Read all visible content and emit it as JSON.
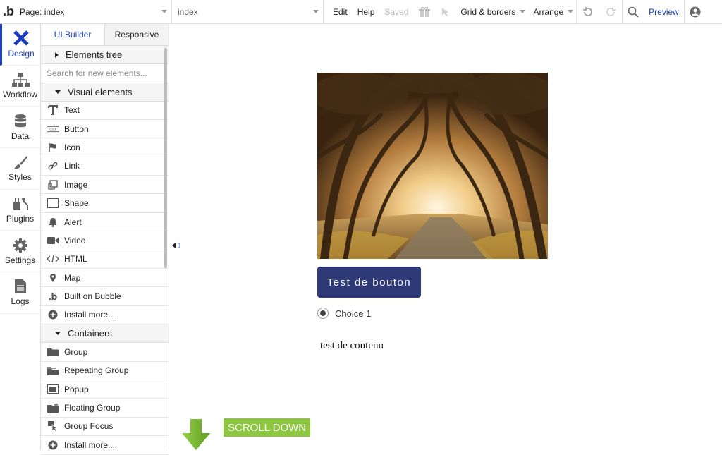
{
  "topbar": {
    "logo": ".b",
    "page_select": "Page: index",
    "element_select": "index",
    "edit": "Edit",
    "help": "Help",
    "saved": "Saved",
    "grid_borders": "Grid & borders",
    "arrange": "Arrange",
    "preview": "Preview"
  },
  "rail": {
    "items": [
      {
        "label": "Design",
        "icon": "design-icon",
        "active": true
      },
      {
        "label": "Workflow",
        "icon": "workflow-icon"
      },
      {
        "label": "Data",
        "icon": "data-icon"
      },
      {
        "label": "Styles",
        "icon": "styles-icon"
      },
      {
        "label": "Plugins",
        "icon": "plugins-icon"
      },
      {
        "label": "Settings",
        "icon": "settings-icon"
      },
      {
        "label": "Logs",
        "icon": "logs-icon"
      }
    ]
  },
  "palette": {
    "tabs": [
      "UI Builder",
      "Responsive"
    ],
    "elements_tree": "Elements tree",
    "search_placeholder": "Search for new elements...",
    "visual_elements_header": "Visual elements",
    "visual_elements": [
      {
        "label": "Text",
        "icon": "text-icon"
      },
      {
        "label": "Button",
        "icon": "button-icon"
      },
      {
        "label": "Icon",
        "icon": "flag-icon"
      },
      {
        "label": "Link",
        "icon": "link-icon"
      },
      {
        "label": "Image",
        "icon": "image-icon"
      },
      {
        "label": "Shape",
        "icon": "shape-icon"
      },
      {
        "label": "Alert",
        "icon": "bell-icon"
      },
      {
        "label": "Video",
        "icon": "video-icon"
      },
      {
        "label": "HTML",
        "icon": "code-icon"
      },
      {
        "label": "Map",
        "icon": "map-pin-icon"
      },
      {
        "label": "Built on Bubble",
        "icon": "bubble-logo-icon"
      },
      {
        "label": "Install more...",
        "icon": "plus-circle-icon"
      }
    ],
    "containers_header": "Containers",
    "containers": [
      {
        "label": "Group",
        "icon": "folder-icon"
      },
      {
        "label": "Repeating Group",
        "icon": "folder-stack-icon"
      },
      {
        "label": "Popup",
        "icon": "popup-icon"
      },
      {
        "label": "Floating Group",
        "icon": "folder-icon"
      },
      {
        "label": "Group Focus",
        "icon": "cursor-icon"
      },
      {
        "label": "Install more...",
        "icon": "plus-circle-icon"
      }
    ]
  },
  "canvas": {
    "button_label": "Test de bouton",
    "radio_choice": "Choice 1",
    "content_text": "test de contenu",
    "scroll_label": "SCROLL DOWN"
  },
  "colors": {
    "accent": "#1d3fbf",
    "button_bg": "#2e3a78",
    "scroll_green": "#8dc63f"
  }
}
